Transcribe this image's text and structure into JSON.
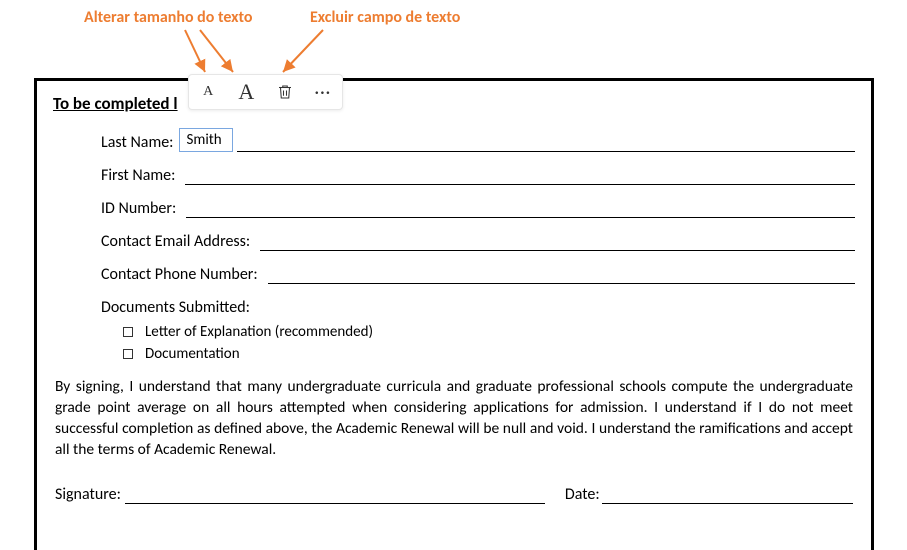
{
  "annotations": {
    "resize_text": "Alterar tamanho do texto",
    "delete_textfield": "Excluir campo de texto"
  },
  "toolbar": {
    "small_a": "A",
    "big_a": "A",
    "more": "···"
  },
  "form": {
    "section_title": "To be completed l",
    "last_name_label": "Last Name:",
    "last_name_value": "Smith",
    "first_name_label": "First Name:",
    "id_number_label": "ID Number:",
    "email_label": "Contact Email Address:",
    "phone_label": "Contact Phone Number:",
    "documents_label": "Documents Submitted:",
    "doc_option_1": "Letter of Explanation (recommended)",
    "doc_option_2": "Documentation",
    "agreement": "By signing, I understand that many undergraduate curricula and graduate professional schools compute the undergraduate grade point average on all hours attempted when considering applications for admission.  I understand if I do not meet successful completion as defined above, the Academic Renewal will be null and void. I understand the ramifications and accept all the terms of Academic Renewal.",
    "signature_label": "Signature:",
    "date_label": "Date:"
  }
}
